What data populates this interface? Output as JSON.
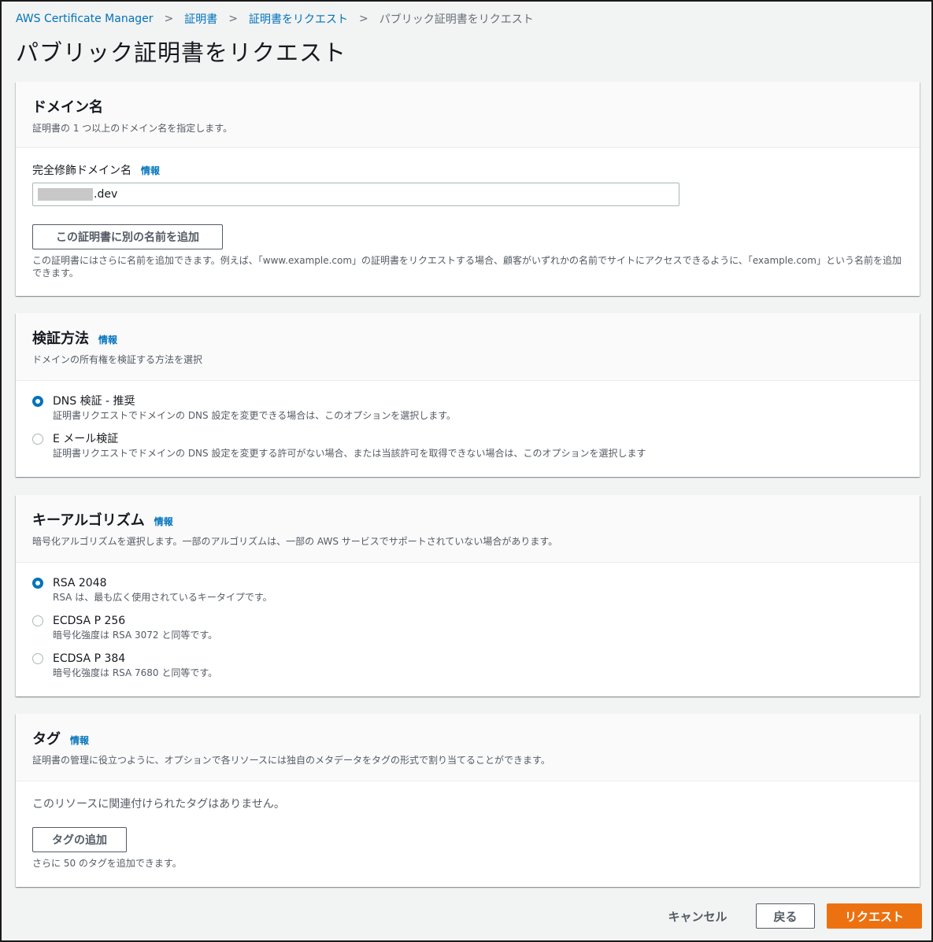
{
  "breadcrumb": {
    "items": [
      "AWS Certificate Manager",
      "証明書",
      "証明書をリクエスト"
    ],
    "current": "パブリック証明書をリクエスト"
  },
  "page": {
    "title": "パブリック証明書をリクエスト"
  },
  "info_label": "情報",
  "domain": {
    "title": "ドメイン名",
    "description": "証明書の 1 つ以上のドメイン名を指定します。",
    "field_label": "完全修飾ドメイン名",
    "field_value": ".dev",
    "add_button": "この証明書に別の名前を追加",
    "help": "この証明書にはさらに名前を追加できます。例えば、「www.example.com」の証明書をリクエストする場合、顧客がいずれかの名前でサイトにアクセスできるように、「example.com」という名前を追加できます。"
  },
  "validation": {
    "title": "検証方法",
    "description": "ドメインの所有権を検証する方法を選択",
    "options": [
      {
        "label": "DNS 検証 - 推奨",
        "desc": "証明書リクエストでドメインの DNS 設定を変更できる場合は、このオプションを選択します。",
        "selected": true
      },
      {
        "label": "E メール検証",
        "desc": "証明書リクエストでドメインの DNS 設定を変更する許可がない場合、または当該許可を取得できない場合は、このオプションを選択します",
        "selected": false
      }
    ]
  },
  "key_algorithm": {
    "title": "キーアルゴリズム",
    "description": "暗号化アルゴリズムを選択します。一部のアルゴリズムは、一部の AWS サービスでサポートされていない場合があります。",
    "options": [
      {
        "label": "RSA 2048",
        "desc": "RSA は、最も広く使用されているキータイプです。",
        "selected": true
      },
      {
        "label": "ECDSA P 256",
        "desc": "暗号化強度は RSA 3072 と同等です。",
        "selected": false
      },
      {
        "label": "ECDSA P 384",
        "desc": "暗号化強度は RSA 7680 と同等です。",
        "selected": false
      }
    ]
  },
  "tags": {
    "title": "タグ",
    "description": "証明書の管理に役立つように、オプションで各リソースには独自のメタデータをタグの形式で割り当てることができます。",
    "empty_text": "このリソースに関連付けられたタグはありません。",
    "add_button": "タグの追加",
    "help": "さらに 50 のタグを追加できます。"
  },
  "footer": {
    "cancel": "キャンセル",
    "back": "戻る",
    "request": "リクエスト"
  },
  "colors": {
    "link": "#0073bb",
    "primary": "#ec7211",
    "background": "#f2f3f3"
  }
}
